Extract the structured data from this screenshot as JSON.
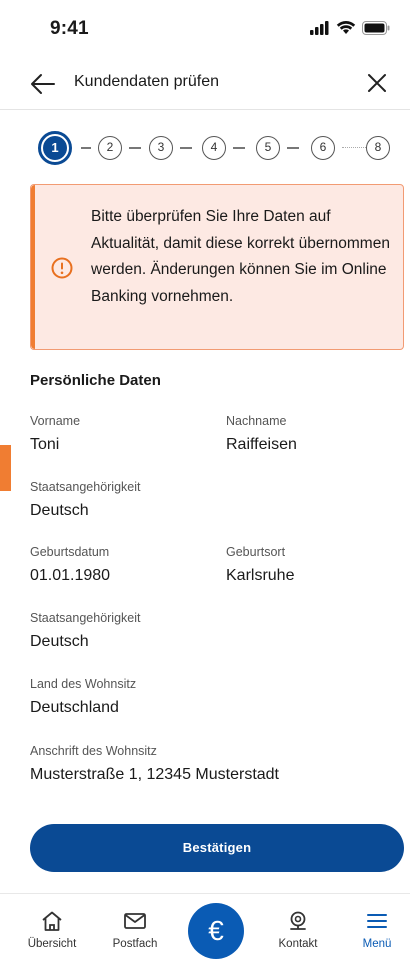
{
  "status_bar": {
    "time": "9:41"
  },
  "header": {
    "title": "Kundendaten prüfen"
  },
  "stepper": {
    "steps": [
      "1",
      "2",
      "3",
      "4",
      "5",
      "6",
      "8"
    ],
    "active": "1"
  },
  "alert": {
    "text": "Bitte überprüfen Sie Ihre Daten auf Aktualität, damit diese korrekt übernommen werden. Änderungen können Sie im Online Banking vornehmen."
  },
  "personal": {
    "title": "Persönliche Daten",
    "firstname_label": "Vorname",
    "firstname": "Toni",
    "lastname_label": "Nachname",
    "lastname": "Raiffeisen",
    "nationality_label": "Staatsangehörigkeit",
    "nationality": "Deutsch",
    "birthdate_label": "Geburtsdatum",
    "birthdate": "01.01.1980",
    "birthplace_label": "Geburtsort",
    "birthplace": "Karlsruhe",
    "nationality2_label": "Staatsangehörigkeit",
    "nationality2": "Deutsch",
    "country_label": "Land des Wohnsitz",
    "country": "Deutschland",
    "address_label": "Anschrift des Wohnsitz",
    "address": "Musterstraße 1, 12345 Musterstadt"
  },
  "actions": {
    "confirm_label": "Bestätigen"
  },
  "tabbar": {
    "overview": "Übersicht",
    "inbox": "Postfach",
    "center_symbol": "€",
    "contact": "Kontakt",
    "menu": "Menü"
  },
  "colors": {
    "primary": "#0a4a94",
    "accent": "#f07d32",
    "alert_bg": "#fde9e3"
  }
}
